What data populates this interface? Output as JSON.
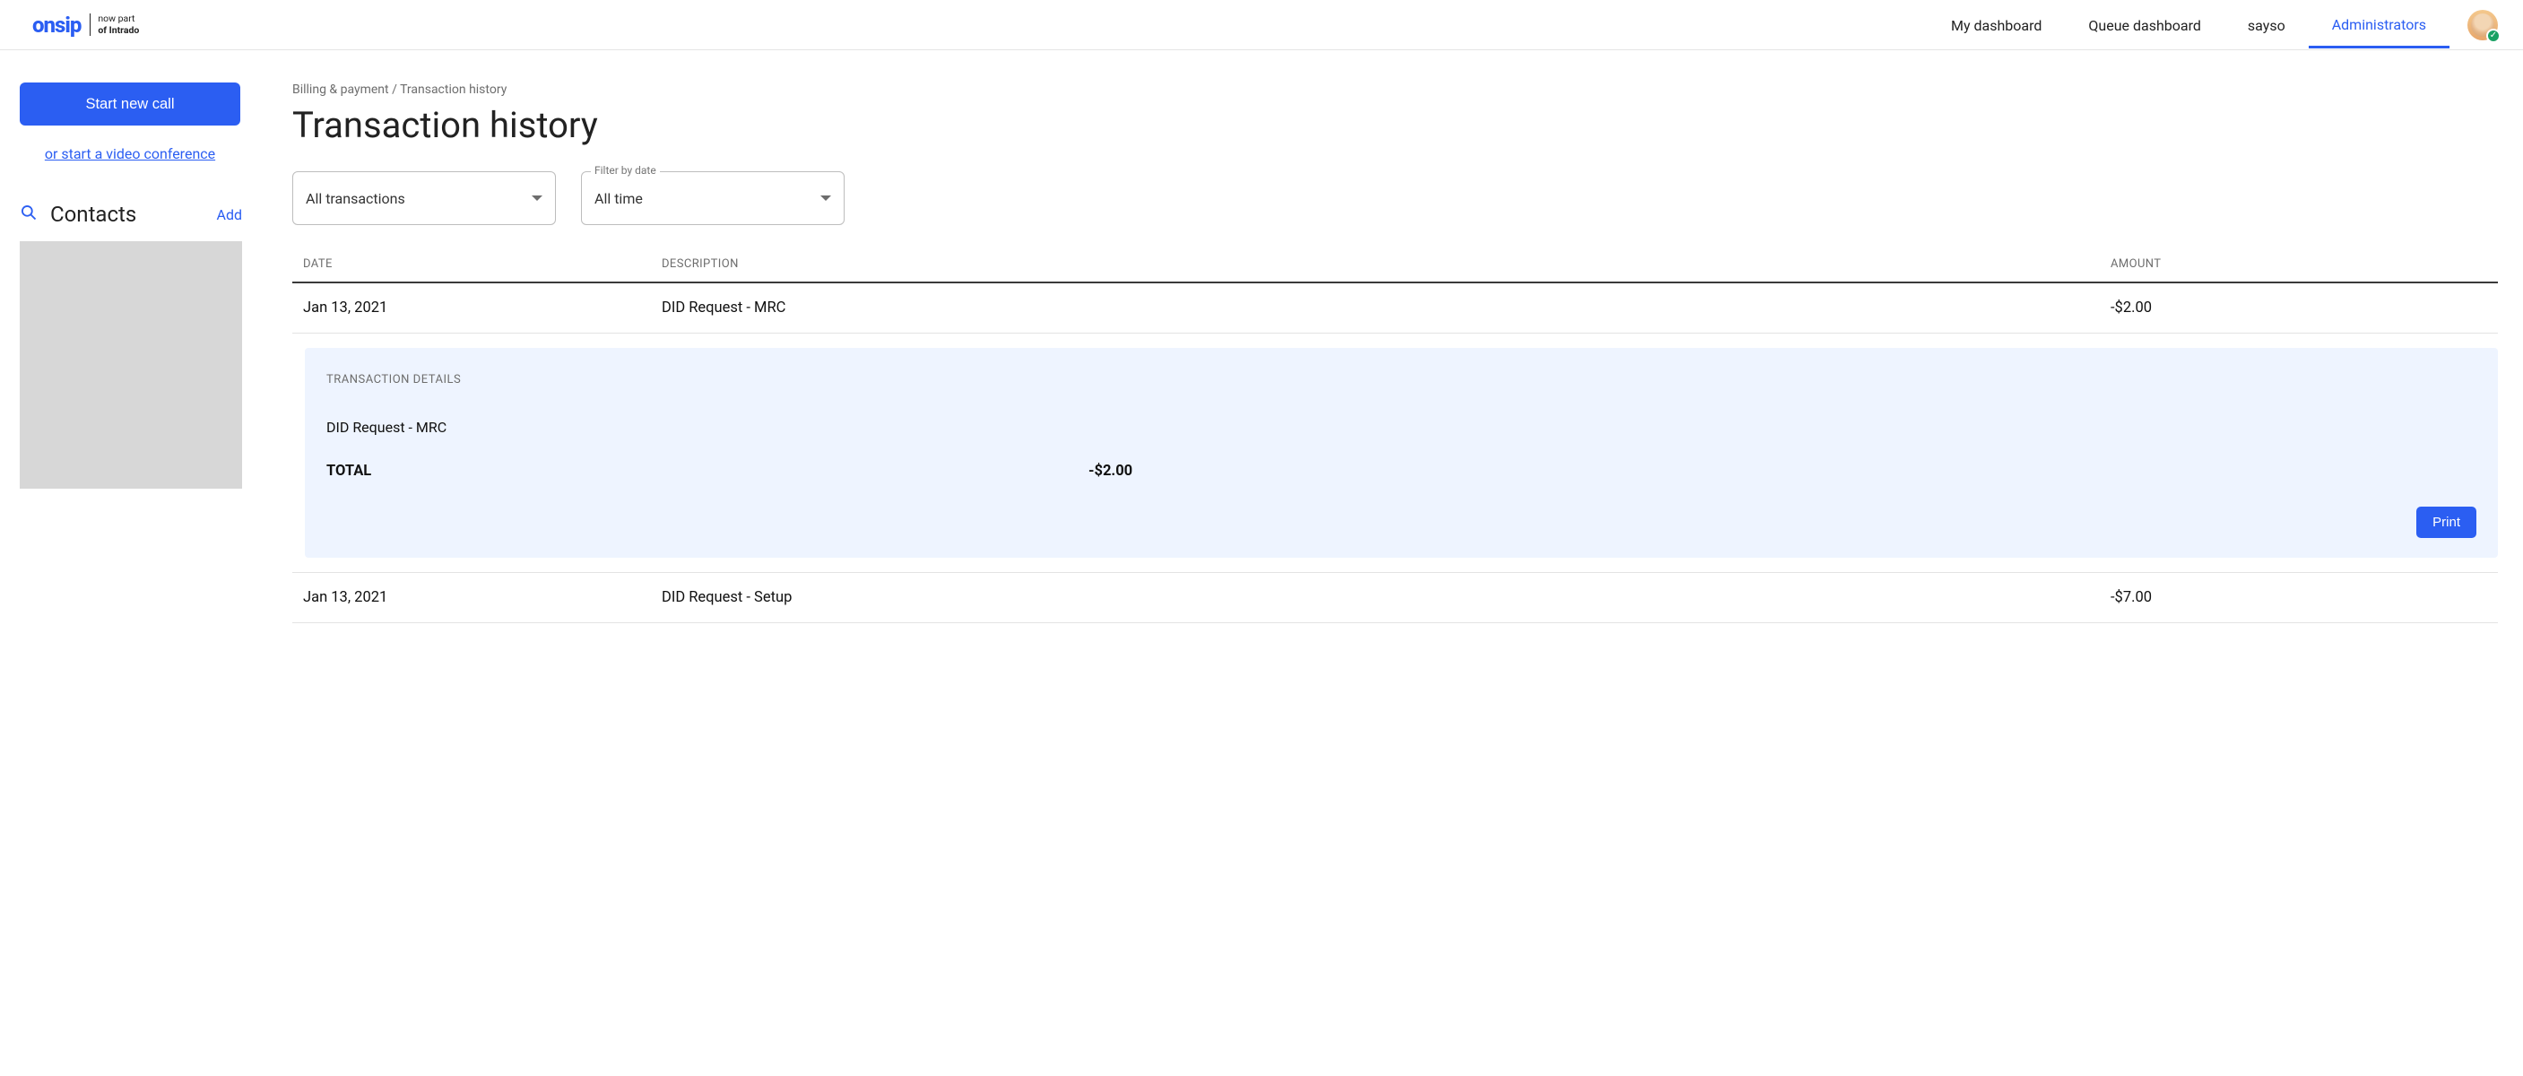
{
  "brand": {
    "logo": "onsip",
    "sub_line1": "now part",
    "sub_line2": "of Intrado"
  },
  "nav": {
    "items": [
      {
        "label": "My dashboard",
        "active": false
      },
      {
        "label": "Queue dashboard",
        "active": false
      },
      {
        "label": "sayso",
        "active": false
      },
      {
        "label": "Administrators",
        "active": true
      }
    ]
  },
  "sidebar": {
    "start_call_label": "Start new call",
    "video_link_label": "or start a video conference",
    "contacts_title": "Contacts",
    "add_label": "Add"
  },
  "breadcrumb": {
    "part1": "Billing & payment",
    "sep": " / ",
    "part2": "Transaction history"
  },
  "page_title": "Transaction history",
  "filters": {
    "type_value": "All transactions",
    "date_label": "Filter by date",
    "date_value": "All time"
  },
  "table": {
    "headers": {
      "date": "DATE",
      "description": "DESCRIPTION",
      "amount": "AMOUNT"
    },
    "rows": [
      {
        "date": "Jan 13, 2021",
        "description": "DID Request - MRC",
        "amount": "-$2.00"
      },
      {
        "date": "Jan 13, 2021",
        "description": "DID Request - Setup",
        "amount": "-$7.00"
      }
    ]
  },
  "details": {
    "title": "TRANSACTION DETAILS",
    "line": "DID Request - MRC",
    "total_label": "TOTAL",
    "total_value": "-$2.00",
    "print_label": "Print"
  }
}
